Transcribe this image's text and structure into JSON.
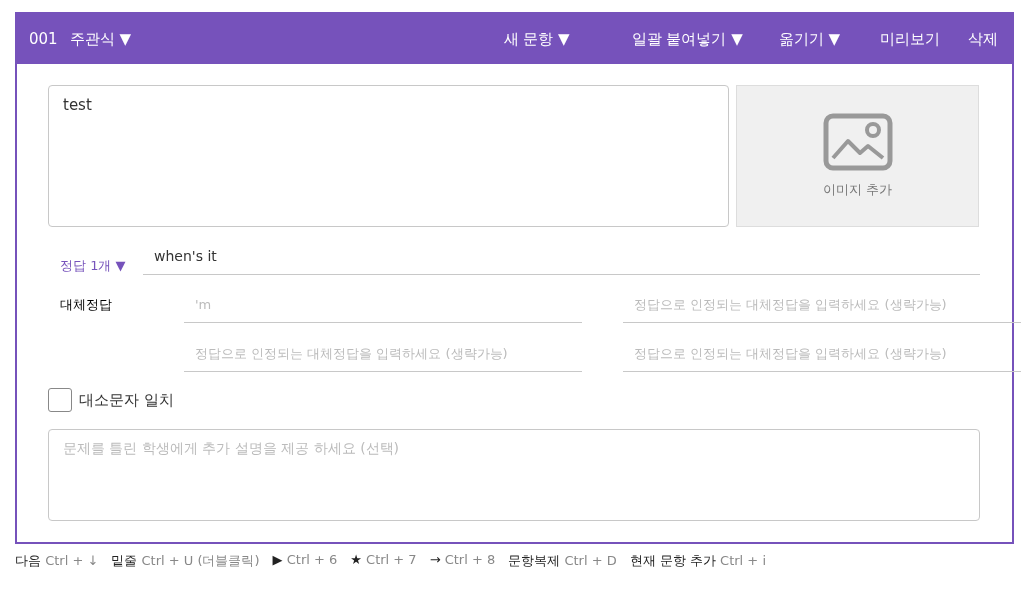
{
  "header": {
    "number": "001",
    "type_menu": "주관식 ▼",
    "actions": [
      {
        "label": "새 문항 ▼"
      },
      {
        "label": "일괄 붙여넣기 ▼"
      },
      {
        "label": "옮기기 ▼"
      },
      {
        "label": "미리보기"
      },
      {
        "label": "삭제"
      }
    ]
  },
  "question": {
    "value": "test"
  },
  "image_button": {
    "label": "이미지 추가"
  },
  "answer": {
    "count_menu": "정답 1개 ▼",
    "value": "when's it"
  },
  "alternates": {
    "label": "대체정답",
    "fields": [
      {
        "placeholder": "'m"
      },
      {
        "placeholder": "정답으로 인정되는 대체정답을 입력하세요 (생략가능)"
      },
      {
        "placeholder": "정답으로 인정되는 대체정답을 입력하세요 (생략가능)"
      },
      {
        "placeholder": "정답으로 인정되는 대체정답을 입력하세요 (생략가능)"
      }
    ]
  },
  "case_match": {
    "label": "대소문자 일치",
    "checked": false
  },
  "explanation": {
    "placeholder": "문제를 틀린 학생에게 추가 설명을 제공 하세요 (선택)"
  },
  "shortcuts": [
    {
      "key": "다음",
      "combo": "Ctrl + ↓"
    },
    {
      "key": "밑줄",
      "combo": "Ctrl + U (더블클릭)"
    },
    {
      "key": "▶",
      "combo": "Ctrl + 6"
    },
    {
      "key": "★",
      "combo": "Ctrl + 7"
    },
    {
      "key": "→",
      "combo": "Ctrl + 8"
    },
    {
      "key": "문항복제",
      "combo": "Ctrl + D"
    },
    {
      "key": "현재 문항 추가",
      "combo": "Ctrl + i"
    }
  ]
}
